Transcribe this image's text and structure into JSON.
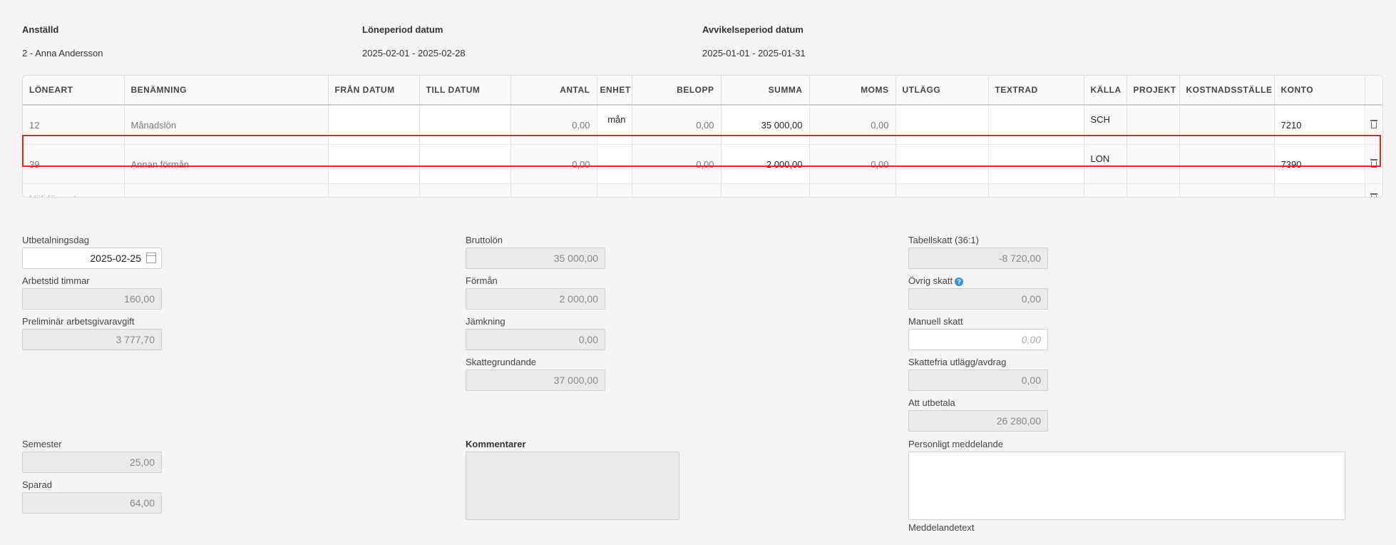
{
  "header": {
    "employee_label": "Anställd",
    "employee_value": "2 - Anna Andersson",
    "period_label": "Löneperiod datum",
    "period_value": "2025-02-01 - 2025-02-28",
    "deviation_label": "Avvikelseperiod datum",
    "deviation_value": "2025-01-01 - 2025-01-31"
  },
  "table": {
    "columns": [
      "LÖNEART",
      "BENÄMNING",
      "FRÅN DATUM",
      "TILL DATUM",
      "ANTAL",
      "ENHET",
      "BELOPP",
      "SUMMA",
      "MOMS",
      "UTLÄGG",
      "TEXTRAD",
      "KÄLLA",
      "PROJEKT",
      "KOSTNADSSTÄLLE",
      "KONTO"
    ],
    "rows": [
      {
        "loneart": "12",
        "benamning": "Månadslön",
        "fran": "",
        "till": "",
        "antal": "0,00",
        "enhet": "mån",
        "belopp": "0,00",
        "summa": "35 000,00",
        "moms": "0,00",
        "utlagg": "",
        "textrad": "",
        "kalla": "SCH",
        "projekt": "",
        "kostnadsstalle": "",
        "konto": "7210"
      },
      {
        "loneart": "39",
        "benamning": "Annan förmån",
        "fran": "",
        "till": "",
        "antal": "0,00",
        "enhet": "",
        "belopp": "0,00",
        "summa": "2 000,00",
        "moms": "0,00",
        "utlagg": "",
        "textrad": "",
        "kalla": "LON",
        "projekt": "",
        "kostnadsstalle": "",
        "konto": "7390"
      }
    ],
    "new_row_placeholder": "Välj löneart",
    "trash_icon": "trash-icon"
  },
  "form": {
    "utbetalningsdag_label": "Utbetalningsdag",
    "utbetalningsdag_value": "2025-02-25",
    "arbetstid_label": "Arbetstid timmar",
    "arbetstid_value": "160,00",
    "arbetsgivaravgift_label": "Preliminär arbetsgivaravgift",
    "arbetsgivaravgift_value": "3 777,70",
    "bruttolon_label": "Bruttolön",
    "bruttolon_value": "35 000,00",
    "forman_label": "Förmån",
    "forman_value": "2 000,00",
    "jamkning_label": "Jämkning",
    "jamkning_value": "0,00",
    "skattegrundande_label": "Skattegrundande",
    "skattegrundande_value": "37 000,00",
    "tabellskatt_label": "Tabellskatt (36:1)",
    "tabellskatt_value": "-8 720,00",
    "ovrig_skatt_label": "Övrig skatt",
    "ovrig_skatt_value": "0,00",
    "manuell_skatt_label": "Manuell skatt",
    "manuell_skatt_placeholder": "0,00",
    "skattefria_label": "Skattefria utlägg/avdrag",
    "skattefria_value": "0,00",
    "att_utbetala_label": "Att utbetala",
    "att_utbetala_value": "26 280,00",
    "semester_label": "Semester",
    "semester_value": "25,00",
    "sparad_label": "Sparad",
    "sparad_value": "64,00",
    "kommentarer_label": "Kommentarer",
    "personligt_label": "Personligt meddelande",
    "meddelandetext_label": "Meddelandetext"
  }
}
